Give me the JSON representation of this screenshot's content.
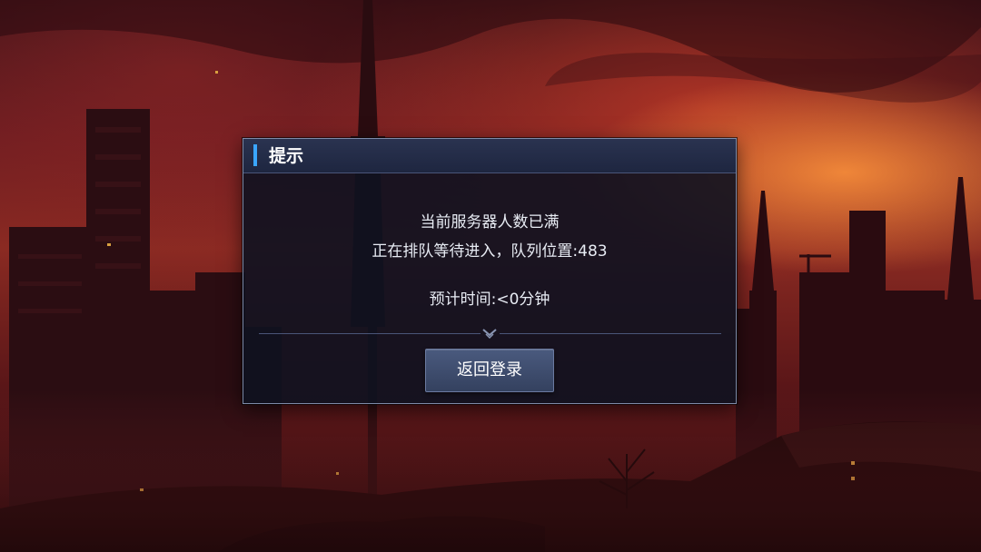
{
  "dialog": {
    "title": "提示",
    "message_line1": "当前服务器人数已满",
    "message_line2": "正在排队等待进入，队列位置:483",
    "message_line3": "预计时间:<0分钟",
    "return_button_label": "返回登录"
  },
  "colors": {
    "accent": "#3aa6ff",
    "dialog_bg": "#0e1220",
    "header_bg": "#2a3350",
    "button_bg": "#4a5a7e",
    "border": "#7d8aa8"
  }
}
